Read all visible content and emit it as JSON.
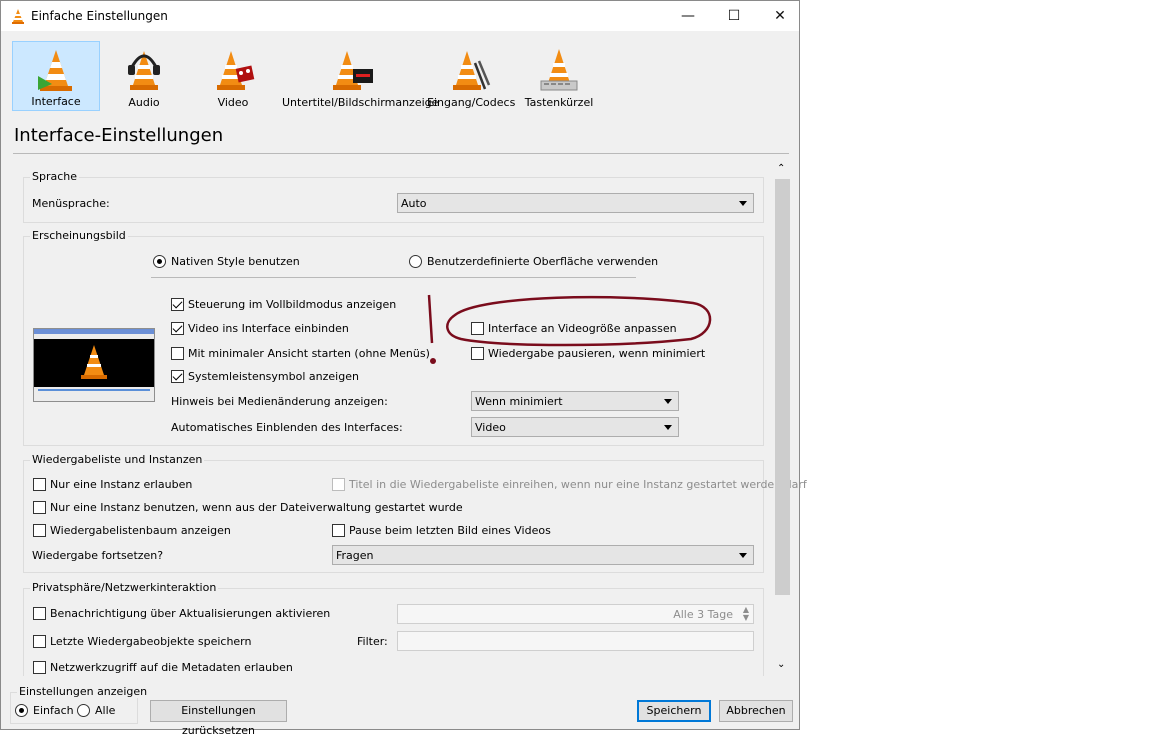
{
  "window": {
    "title": "Einfache Einstellungen",
    "minimize": "—",
    "maximize": "☐",
    "close": "✕"
  },
  "toolbar": {
    "items": [
      {
        "label": "Interface",
        "icon": "vlc-cone-interface-icon",
        "selected": true
      },
      {
        "label": "Audio",
        "icon": "vlc-cone-headphones-icon"
      },
      {
        "label": "Video",
        "icon": "vlc-cone-film-icon"
      },
      {
        "label": "Untertitel/Bildschirmanzeige",
        "icon": "vlc-cone-subtitle-icon"
      },
      {
        "label": "Eingang/Codecs",
        "icon": "vlc-cone-cable-icon"
      },
      {
        "label": "Tastenkürzel",
        "icon": "vlc-cone-keyboard-icon"
      }
    ]
  },
  "page_title": "Interface-Einstellungen",
  "sprache": {
    "group_title": "Sprache",
    "label": "Menüsprache:",
    "value": "Auto"
  },
  "erscheinungsbild": {
    "group_title": "Erscheinungsbild",
    "radio_native": "Nativen Style benutzen",
    "radio_custom": "Benutzerdefinierte Oberfläche verwenden",
    "cb_vollbild": "Steuerung im Vollbildmodus anzeigen",
    "cb_einbinden": "Video ins Interface einbinden",
    "cb_minimal": "Mit minimaler Ansicht starten (ohne Menüs)",
    "cb_systray": "Systemleistensymbol anzeigen",
    "cb_videogroesse": "Interface an Videogröße anpassen",
    "cb_pausieren": "Wiedergabe pausieren, wenn minimiert",
    "hinweis_label": "Hinweis bei Medienänderung anzeigen:",
    "hinweis_value": "Wenn minimiert",
    "auto_label": "Automatisches Einblenden des Interfaces:",
    "auto_value": "Video",
    "annotation": "!"
  },
  "playlist": {
    "group_title": "Wiedergabeliste und Instanzen",
    "cb_eine_instanz": "Nur eine Instanz erlauben",
    "cb_titel": "Titel in die Wiedergabeliste einreihen, wenn nur eine Instanz gestartet werden darf",
    "cb_dateiverwaltung": "Nur eine Instanz benutzen, wenn aus der Dateiverwaltung gestartet wurde",
    "cb_baum": "Wiedergabelistenbaum anzeigen",
    "cb_pause_bild": "Pause beim letzten Bild eines Videos",
    "fortsetzen_label": "Wiedergabe fortsetzen?",
    "fortsetzen_value": "Fragen"
  },
  "privacy": {
    "group_title": "Privatsphäre/Netzwerkinteraktion",
    "cb_updates": "Benachrichtigung über Aktualisierungen aktivieren",
    "updates_value": "Alle 3 Tage",
    "cb_letzte": "Letzte Wiedergabeobjekte speichern",
    "filter_label": "Filter:",
    "cb_netzwerk": "Netzwerkzugriff auf die Metadaten erlauben"
  },
  "footer": {
    "show_label": "Einstellungen anzeigen",
    "radio_einfach": "Einfach",
    "radio_alle": "Alle",
    "reset_button": "Einstellungen zurücksetzen",
    "save_button": "Speichern",
    "cancel_button": "Abbrechen"
  },
  "colors": {
    "selected_tab_bg": "#cce8ff",
    "annotation": "#7a0c1c",
    "cone_orange": "#f28c13"
  }
}
